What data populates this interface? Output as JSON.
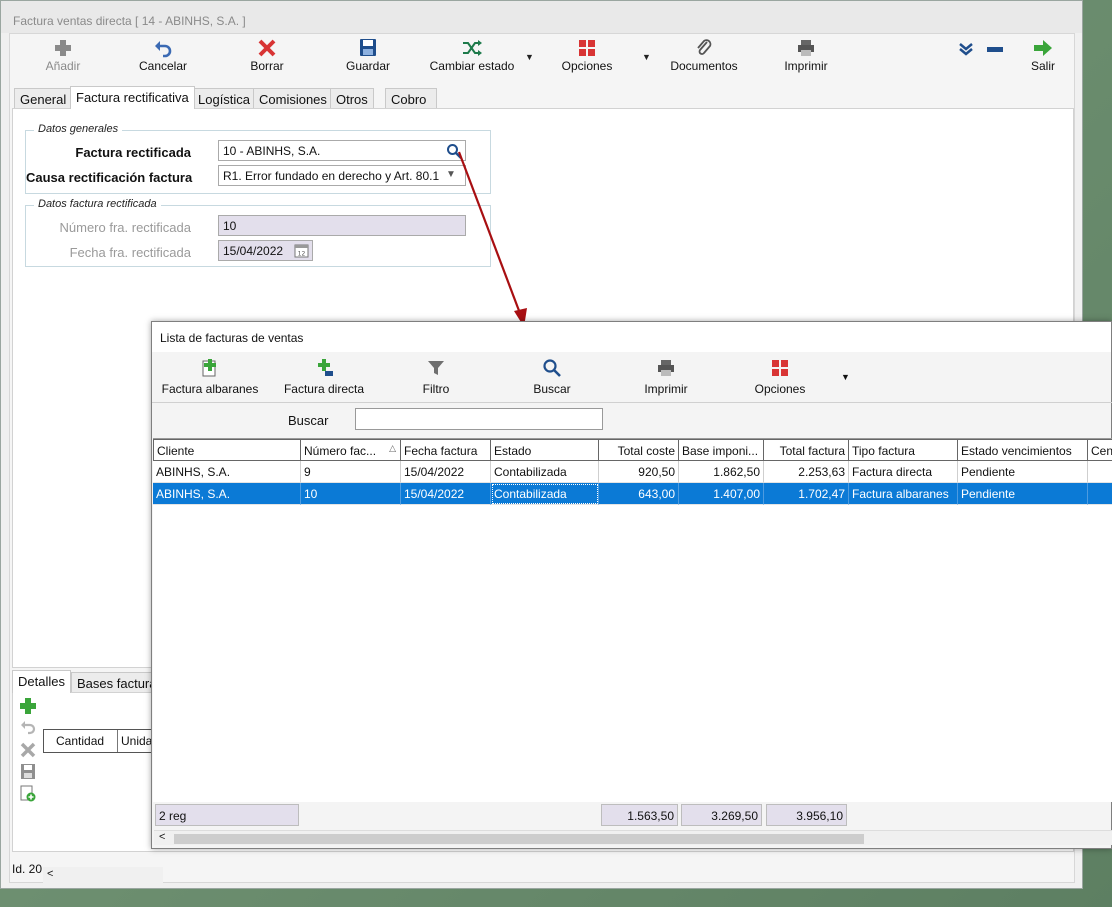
{
  "main_window": {
    "title": "Factura ventas directa  [ 14  -  ABINHS, S.A. ]",
    "toolbar": {
      "add": "Añadir",
      "cancel": "Cancelar",
      "delete": "Borrar",
      "save": "Guardar",
      "change_state": "Cambiar estado",
      "options": "Opciones",
      "documents": "Documentos",
      "print": "Imprimir",
      "exit": "Salir"
    },
    "tabs": [
      "General",
      "Factura rectificativa",
      "Logística",
      "Comisiones",
      "Otros",
      "Cobro"
    ],
    "datos_generales": {
      "legend": "Datos generales",
      "factura_rectificada_label": "Factura rectificada",
      "factura_rectificada_value": "10  -  ABINHS, S.A.",
      "causa_label": "Causa rectificación factura",
      "causa_value": "R1. Error fundado en derecho y Art. 80.1"
    },
    "datos_factura_rectificada": {
      "legend": "Datos factura rectificada",
      "numero_label": "Número fra. rectificada",
      "numero_value": "10",
      "fecha_label": "Fecha fra. rectificada",
      "fecha_value": "15/04/2022"
    },
    "detail_tabs": [
      "Detalles",
      "Bases factura"
    ],
    "detail_columns": [
      "Cantidad",
      "Unida"
    ],
    "status": "Id. 20"
  },
  "dialog": {
    "title": "Lista de facturas de ventas",
    "toolbar": {
      "factura_albaranes": "Factura albaranes",
      "factura_directa": "Factura directa",
      "filtro": "Filtro",
      "buscar": "Buscar",
      "imprimir": "Imprimir",
      "opciones": "Opciones"
    },
    "search_label": "Buscar",
    "search_value": "",
    "columns": [
      "Cliente",
      "Número fac...",
      "Fecha factura",
      "Estado",
      "Total coste",
      "Base imponi...",
      "Total factura",
      "Tipo factura",
      "Estado vencimientos",
      "Cen"
    ],
    "rows": [
      [
        "ABINHS, S.A.",
        "9",
        "15/04/2022",
        "Contabilizada",
        "920,50",
        "1.862,50",
        "2.253,63",
        "Factura directa",
        "Pendiente",
        ""
      ],
      [
        "ABINHS, S.A.",
        "10",
        "15/04/2022",
        "Contabilizada",
        "643,00",
        "1.407,00",
        "1.702,47",
        "Factura albaranes",
        "Pendiente",
        ""
      ]
    ],
    "selected_row": 1,
    "footer": {
      "count": "2 reg",
      "total_coste": "1.563,50",
      "base_imponible": "3.269,50",
      "total_factura": "3.956,10"
    }
  },
  "colors": {
    "selection": "#0b7ad6",
    "readonly_field": "#e3dfec",
    "arrow": "#a80f12",
    "icon_blue": "#1f4e8c",
    "icon_red": "#d83434",
    "icon_green": "#3aa53a"
  }
}
